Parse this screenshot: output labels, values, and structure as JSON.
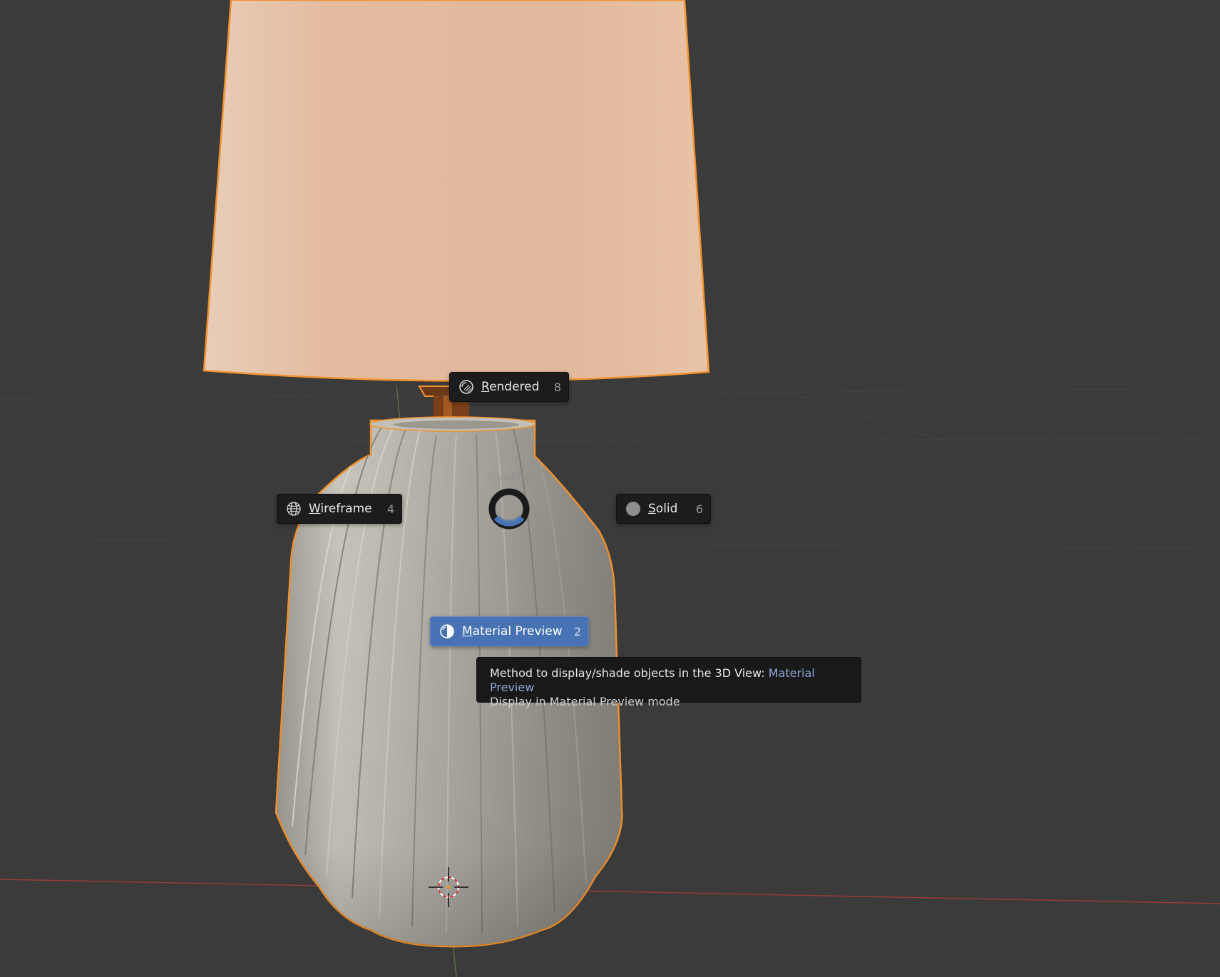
{
  "pie_menu": {
    "title": "Shading",
    "items": [
      {
        "id": "rendered",
        "underline": "R",
        "rest": "endered",
        "shortcut": "8",
        "icon": "rendered-shading-icon"
      },
      {
        "id": "wireframe",
        "underline": "W",
        "rest": "ireframe",
        "shortcut": "4",
        "icon": "wireframe-shading-icon"
      },
      {
        "id": "solid",
        "underline": "S",
        "rest": "olid",
        "shortcut": "6",
        "icon": "solid-shading-icon"
      },
      {
        "id": "material_preview",
        "underline": "M",
        "rest": "aterial Preview",
        "shortcut": "2",
        "icon": "material-preview-shading-icon",
        "active": true
      }
    ]
  },
  "tooltip": {
    "prefix": "Method to display/shade objects in the 3D View: ",
    "value": "Material Preview",
    "description": "Display in Material Preview mode"
  },
  "colors": {
    "viewport_bg": "#3b3b3b",
    "active_accent": "#4772b3",
    "selection_outline": "#f0922e",
    "lampshade": "#e3bb9e",
    "vase": "#b3b0a8"
  }
}
